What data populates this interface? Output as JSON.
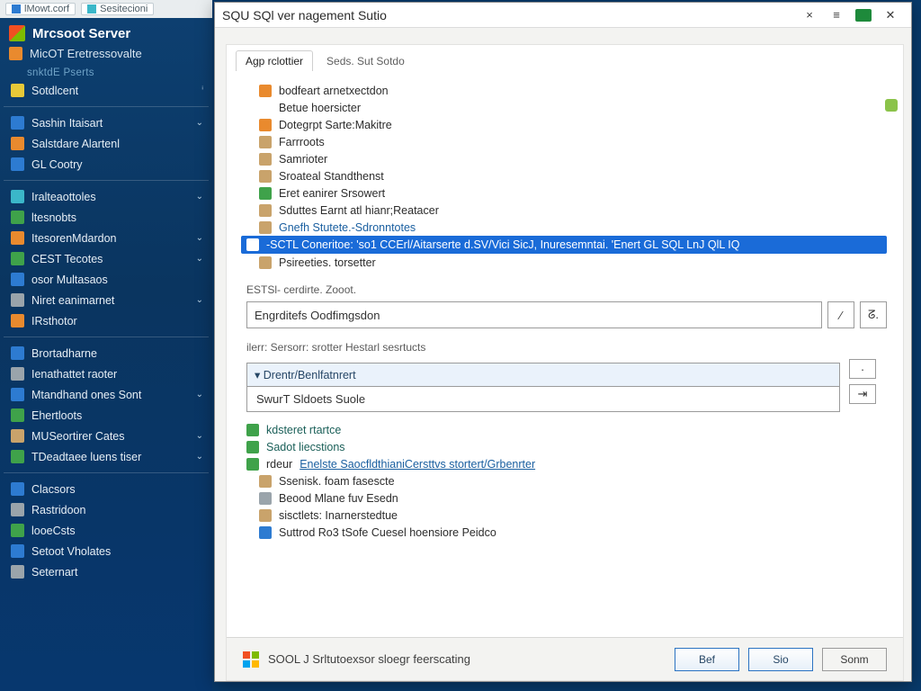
{
  "os_top": {
    "left": "lMowt.corf",
    "right": "Sesitecioni"
  },
  "sidebar": {
    "brand1": "Mrcsoot Server",
    "brand2": "MicOT Eretressovalte",
    "dim1": "snktdE Pserts",
    "item_solution": "Sotdlcent",
    "groups": [
      {
        "items": [
          {
            "label": "Sashin Itaisart",
            "color": "c-bl",
            "chev": true
          },
          {
            "label": "Salstdare Alartenl",
            "color": "c-or",
            "chev": false
          },
          {
            "label": "GL Cootry",
            "color": "c-bl",
            "chev": false
          }
        ]
      },
      {
        "items": [
          {
            "label": "Iralteaottoles",
            "color": "c-cy",
            "chev": true
          },
          {
            "label": "ltesnobts",
            "color": "c-gn",
            "chev": false
          },
          {
            "label": "ItesorenMdardon",
            "color": "c-or",
            "chev": true
          },
          {
            "label": "CEST Tecotes",
            "color": "c-gn",
            "chev": true
          },
          {
            "label": "osor Multasaos",
            "color": "c-bl",
            "chev": false
          },
          {
            "label": "Niret eanimarnet",
            "color": "c-gy",
            "chev": true
          },
          {
            "label": "IRsthotor",
            "color": "c-or",
            "chev": false
          }
        ]
      },
      {
        "items": [
          {
            "label": "Brortadharne",
            "color": "c-bl",
            "chev": false
          },
          {
            "label": "Ienathattet raoter",
            "color": "c-gy",
            "chev": false
          },
          {
            "label": "Mtandhand ones Sont",
            "color": "c-bl",
            "chev": true
          },
          {
            "label": "Ehertloots",
            "color": "c-gn",
            "chev": false
          },
          {
            "label": "MUSeortirer Cates",
            "color": "c-tn",
            "chev": true
          },
          {
            "label": "TDeadtaee luens tiser",
            "color": "c-gn",
            "chev": true
          }
        ]
      },
      {
        "items": [
          {
            "label": "Clacsors",
            "color": "c-bl",
            "chev": false
          },
          {
            "label": "Rastridoon",
            "color": "c-gy",
            "chev": false
          },
          {
            "label": "looeCsts",
            "color": "c-gn",
            "chev": false
          },
          {
            "label": "Setoot Vholates",
            "color": "c-bl",
            "chev": false
          },
          {
            "label": "Seternart",
            "color": "c-gy",
            "chev": false
          }
        ]
      }
    ]
  },
  "window": {
    "title": "SQU SQl ver nagement Sutio",
    "tabs": [
      {
        "label": "Agp rclottier",
        "active": true
      },
      {
        "label": "Seds. Sut Sotdo",
        "active": false
      }
    ],
    "list1": [
      {
        "label": "bodfeart arnetxectdon",
        "color": "c-or"
      },
      {
        "label": "Betue hoersicter",
        "color": ""
      },
      {
        "label": "Dotegrpt Sarte:Makitre",
        "color": "c-or"
      },
      {
        "label": "Farrroots",
        "color": "c-tn"
      },
      {
        "label": "Samrioter",
        "color": "c-tn"
      },
      {
        "label": "Sroateal Standthenst",
        "color": "c-tn"
      },
      {
        "label": "Eret eanirer Srsowert",
        "color": "c-gn"
      },
      {
        "label": "Sduttes Earnt atl hianr;Reatacer",
        "color": "c-tn"
      },
      {
        "label": "Gnefh Stutete.-Sdronntotes",
        "color": "c-tn",
        "link": true
      }
    ],
    "selected_row": "-SCTL Coneritoe: 'so1 CCErl/Aitarserte d.SV/Vici SicJ, Inuresemntai. 'Enert GL SQL LnJ QlL IQ",
    "list1_tail": {
      "label": "Psireeties. torsetter",
      "color": "c-tn"
    },
    "section1_label": "ESTSl- cerdirte. Zooot.",
    "textbox_value": "Engrditefs Oodfimgsdon",
    "section2_label": "ilerr: Sersorr: srotter Hestarl sesrtucts",
    "list_header": "Drentr/Benlfatnrert",
    "list_row": "SwurT Sldoets Suole",
    "links_block": [
      {
        "label": "kdsteret rtartce",
        "color": "c-gn",
        "link": false
      },
      {
        "label": "Sadot liecstions",
        "color": "c-gn",
        "link": false
      }
    ],
    "deep_link_prefix": "rdeur",
    "deep_link": "Enelste SaocfldthianiCersttvs stortert/Grbenrter",
    "list2": [
      {
        "label": "Ssenisk. foam fasescte",
        "color": "c-tn"
      },
      {
        "label": "Beood Mlane fuv Esedn",
        "color": "c-gy"
      },
      {
        "label": "sisctlets: Inarnerstedtue",
        "color": "c-tn"
      },
      {
        "label": "Suttrod Ro3 tSofe Cuesel hoensiore Peidco",
        "color": "c-bl"
      }
    ],
    "footer_text": "SOOL J Srltutoexsor sloegr feerscating",
    "buttons": {
      "back": "Bef",
      "next": "Sio",
      "cancel": "Sonm"
    }
  },
  "colors": {
    "selection": "#1a6bd8",
    "accent": "#2b73c2"
  }
}
